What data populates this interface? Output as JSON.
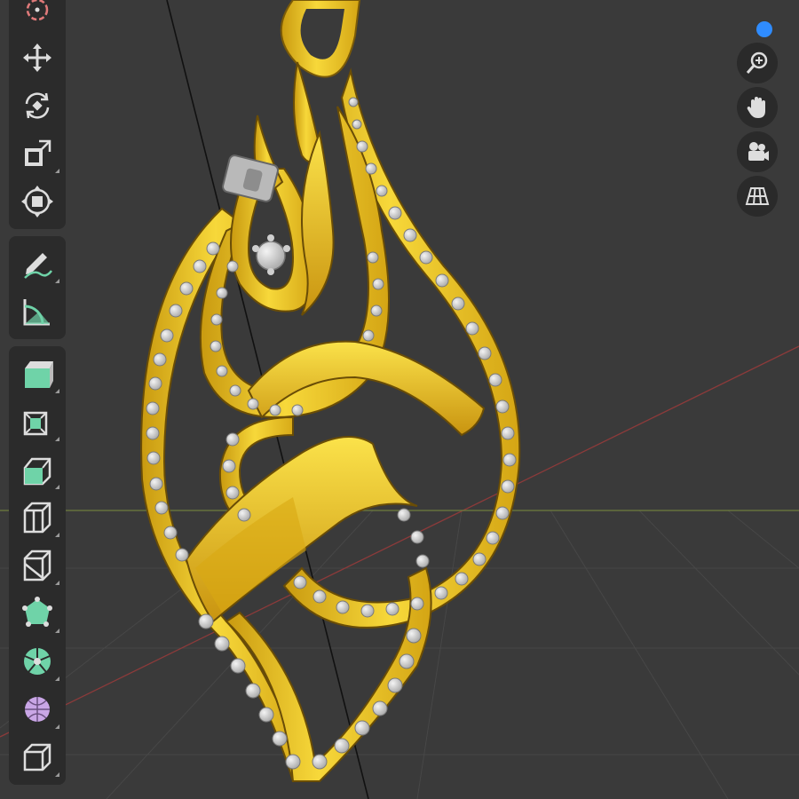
{
  "viewport": {
    "colors": {
      "background": "#3a3a3a",
      "gold": "#f2cc2a",
      "gem": "#d9d9d9",
      "toolbar": "#2b2b2b",
      "accent": "#2f8cff",
      "tool_green": "#6fd3a8"
    }
  },
  "toolbar": {
    "tools": [
      {
        "name": "cursor-tool",
        "icon": "cursor-icon"
      },
      {
        "name": "move-tool",
        "icon": "move-icon"
      },
      {
        "name": "rotate-tool",
        "icon": "rotate-icon"
      },
      {
        "name": "scale-tool",
        "icon": "scale-icon"
      },
      {
        "name": "transform-tool",
        "icon": "transform-icon"
      },
      {
        "name": "annotate-tool",
        "icon": "annotate-icon"
      },
      {
        "name": "measure-tool",
        "icon": "measure-icon"
      },
      {
        "name": "add-cube-tool",
        "icon": "add-cube-icon"
      },
      {
        "name": "extrude-tool",
        "icon": "extrude-icon"
      },
      {
        "name": "inset-tool",
        "icon": "inset-icon"
      },
      {
        "name": "bevel-tool",
        "icon": "bevel-icon"
      },
      {
        "name": "loop-cut-tool",
        "icon": "loop-cut-icon"
      },
      {
        "name": "knife-tool",
        "icon": "knife-icon"
      },
      {
        "name": "poly-build-tool",
        "icon": "poly-build-icon"
      },
      {
        "name": "spin-tool",
        "icon": "spin-icon"
      },
      {
        "name": "smooth-tool",
        "icon": "smooth-icon"
      },
      {
        "name": "shear-tool",
        "icon": "shear-icon"
      }
    ]
  },
  "navigation": {
    "buttons": [
      {
        "name": "zoom-button",
        "icon": "zoom-icon"
      },
      {
        "name": "pan-button",
        "icon": "hand-icon"
      },
      {
        "name": "camera-button",
        "icon": "camera-icon"
      },
      {
        "name": "ortho-toggle-button",
        "icon": "grid-icon"
      }
    ]
  }
}
